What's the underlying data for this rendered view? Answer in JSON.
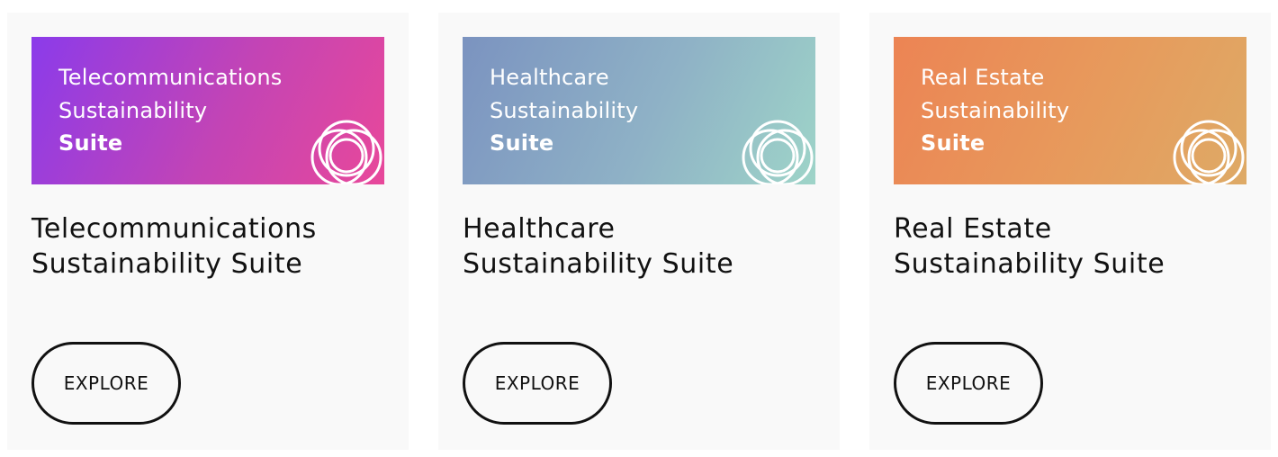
{
  "cards": [
    {
      "banner_lines": [
        "Telecommunications",
        "Sustainability",
        "Suite"
      ],
      "title_lines": [
        "Telecommunications",
        "Sustainability Suite"
      ],
      "button_label": "EXPLORE",
      "gradient": [
        "#8b3bea",
        "#e8489a"
      ],
      "icon": "overlapping-circles-icon"
    },
    {
      "banner_lines": [
        "Healthcare",
        "Sustainability",
        "Suite"
      ],
      "title_lines": [
        "Healthcare",
        "Sustainability Suite"
      ],
      "button_label": "EXPLORE",
      "gradient": [
        "#7b93c0",
        "#9ed4c8"
      ],
      "icon": "overlapping-circles-icon"
    },
    {
      "banner_lines": [
        "Real Estate",
        "Sustainability",
        "Suite"
      ],
      "title_lines": [
        "Real Estate",
        "Sustainability Suite"
      ],
      "button_label": "EXPLORE",
      "gradient": [
        "#ec8454",
        "#deaa66"
      ],
      "icon": "overlapping-circles-icon"
    }
  ]
}
